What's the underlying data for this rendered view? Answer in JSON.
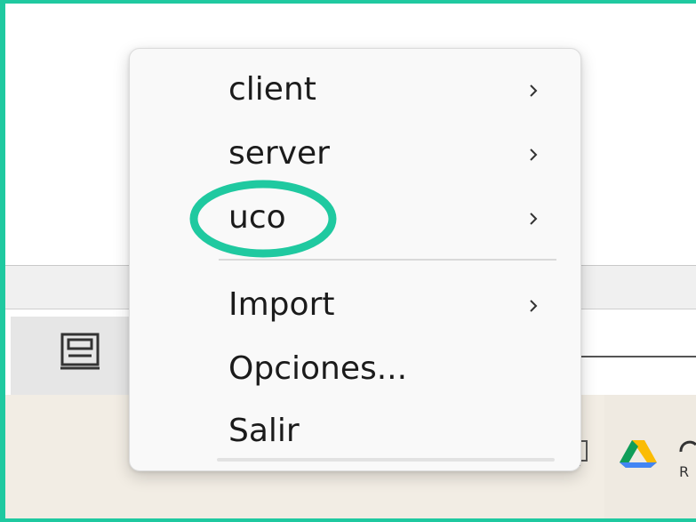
{
  "menu": {
    "items": [
      {
        "label": "client",
        "submenu": true
      },
      {
        "label": "server",
        "submenu": true
      },
      {
        "label": "uco",
        "submenu": true
      },
      {
        "label": "Import",
        "submenu": true
      },
      {
        "label": "Opciones...",
        "submenu": false
      },
      {
        "label": "Salir",
        "submenu": false
      }
    ]
  },
  "icons": {
    "toolbar_left": "panel-icon",
    "taskbar": [
      "device-icon",
      "google-drive-icon",
      "partial-tray-icon"
    ],
    "submenu_indicator": "chevron-right-icon"
  },
  "colors": {
    "annotation": "#1fc9a0",
    "menu_background": "#f9f9f9",
    "text": "#1b1b1b",
    "taskbar_background": "#f2ede4"
  }
}
